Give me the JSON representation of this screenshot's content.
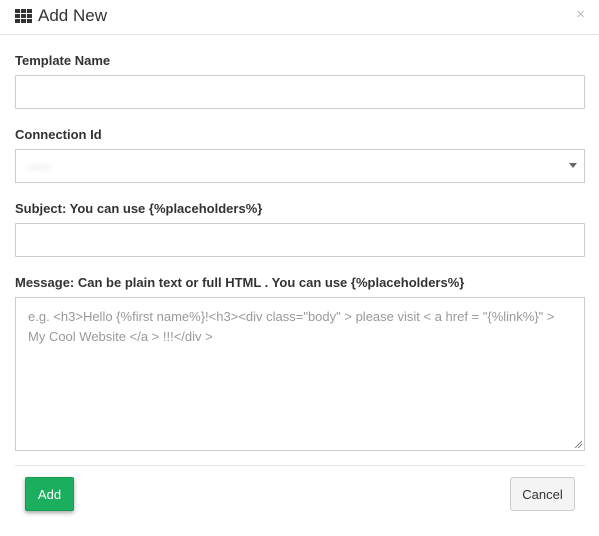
{
  "modal": {
    "title": "Add New",
    "close_symbol": "×",
    "title_icon": "grid-icon",
    "close_icon": "close-icon"
  },
  "form": {
    "template_name": {
      "label": "Template Name",
      "value": ""
    },
    "connection_id": {
      "label": "Connection Id",
      "value": "-----"
    },
    "subject": {
      "label": "Subject: You can use {%placeholders%}",
      "value": ""
    },
    "message": {
      "label": "Message: Can be plain text or full HTML . You can use {%placeholders%}",
      "placeholder": "e.g. <h3>Hello {%first name%}!<h3><div class=\"body\" > please visit < a href = \"{%link%}\" > My Cool Website </a > !!!</div >"
    }
  },
  "footer": {
    "add_label": "Add",
    "cancel_label": "Cancel"
  },
  "colors": {
    "accent": "#1aae5e",
    "border": "#cccccc"
  }
}
